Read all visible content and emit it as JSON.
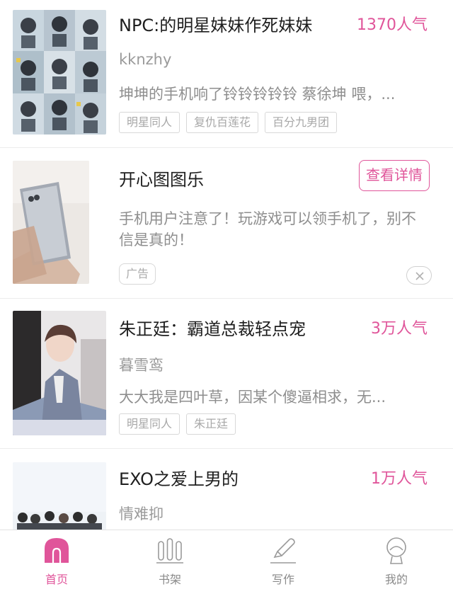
{
  "feed": {
    "items": [
      {
        "title": "NPC:的明星妹妹作死妹妹",
        "popularity": "1370人气",
        "author": "kknzhy",
        "summary": "坤坤的手机响了铃铃铃铃铃 蔡徐坤 喂，...",
        "tags": [
          "明星同人",
          "复仇百莲花",
          "百分九男团"
        ]
      },
      {
        "title": "朱正廷：霸道总裁轻点宠",
        "popularity": "3万人气",
        "author": "暮雪鸾",
        "summary": "大大我是四叶草，因某个傻逼相求，无...",
        "tags": [
          "明星同人",
          "朱正廷"
        ]
      },
      {
        "title": "EXO之爱上男的",
        "popularity": "1万人气",
        "author": "情难抑"
      }
    ],
    "ad": {
      "title": "开心图图乐",
      "button_label": "查看详情",
      "text": "手机用户注意了！玩游戏可以领手机了，别不信是真的！",
      "badge": "广告"
    }
  },
  "tabbar": {
    "tabs": [
      {
        "label": "首页",
        "icon": "home-icon",
        "active": true
      },
      {
        "label": "书架",
        "icon": "bookshelf-icon",
        "active": false
      },
      {
        "label": "写作",
        "icon": "pen-icon",
        "active": false
      },
      {
        "label": "我的",
        "icon": "profile-icon",
        "active": false
      }
    ]
  },
  "colors": {
    "accent": "#e0559a",
    "text_primary": "#1e1e1e",
    "text_secondary": "#8e8e8e",
    "divider": "#ececec"
  }
}
